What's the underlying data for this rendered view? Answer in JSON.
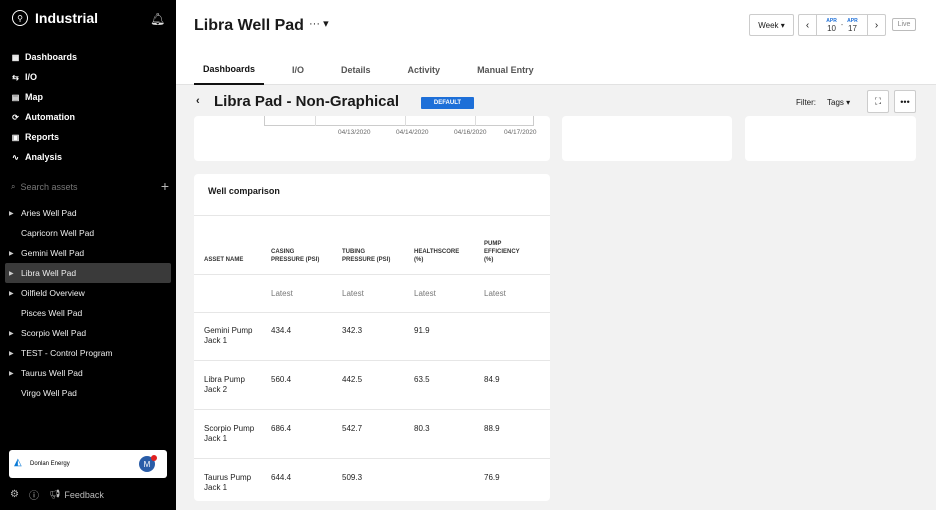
{
  "sidebar": {
    "brand": "Industrial",
    "nav": [
      {
        "icon": "grid-icon",
        "glyph": "▦",
        "label": "Dashboards"
      },
      {
        "icon": "io-icon",
        "glyph": "⇆",
        "label": "I/O"
      },
      {
        "icon": "map-icon",
        "glyph": "▤",
        "label": "Map"
      },
      {
        "icon": "automation-icon",
        "glyph": "⟳",
        "label": "Automation"
      },
      {
        "icon": "reports-icon",
        "glyph": "▣",
        "label": "Reports"
      },
      {
        "icon": "analysis-icon",
        "glyph": "∿",
        "label": "Analysis"
      }
    ],
    "search_placeholder": "Search assets",
    "assets": [
      {
        "label": "Aries Well Pad",
        "expandable": true
      },
      {
        "label": "Capricorn Well Pad",
        "expandable": false
      },
      {
        "label": "Gemini Well Pad",
        "expandable": true
      },
      {
        "label": "Libra Well Pad",
        "expandable": true,
        "active": true
      },
      {
        "label": "Oilfield Overview",
        "expandable": true
      },
      {
        "label": "Pisces Well Pad",
        "expandable": false
      },
      {
        "label": "Scorpio Well Pad",
        "expandable": true
      },
      {
        "label": "TEST - Control Program",
        "expandable": true
      },
      {
        "label": "Taurus Well Pad",
        "expandable": true
      },
      {
        "label": "Virgo Well Pad",
        "expandable": false
      }
    ],
    "org": {
      "name": "Donlan Energy",
      "avatar": "M"
    },
    "footer": {
      "feedback": "Feedback"
    }
  },
  "header": {
    "title": "Libra Well Pad",
    "more": "···",
    "week": "Week",
    "date_start": {
      "month": "APR",
      "day": "10"
    },
    "date_end": {
      "month": "APR",
      "day": "17"
    },
    "date_sep": "-",
    "live": "Live",
    "tabs": [
      "Dashboards",
      "I/O",
      "Details",
      "Activity",
      "Manual Entry"
    ]
  },
  "dashboard": {
    "title": "Libra Pad - Non-Graphical",
    "badge": "DEFAULT",
    "filter_label": "Filter:",
    "tags_label": "Tags"
  },
  "chart_data": {
    "type": "line",
    "x_ticks": [
      "04/13/2020",
      "04/14/2020",
      "04/16/2020",
      "04/17/2020"
    ]
  },
  "table": {
    "title": "Well comparison",
    "columns": [
      [
        "ASSET NAME"
      ],
      [
        "CASING",
        "PRESSURE (PSI)"
      ],
      [
        "TUBING",
        "PRESSURE (PSI)"
      ],
      [
        "HEALTHSCORE",
        "(%)"
      ],
      [
        "PUMP",
        "EFFICIENCY",
        "(%)"
      ]
    ],
    "sub": "Latest",
    "rows": [
      {
        "name": [
          "Gemini Pump",
          "Jack 1"
        ],
        "casing": "434.4",
        "tubing": "342.3",
        "health": "91.9",
        "pump": ""
      },
      {
        "name": [
          "Libra Pump",
          "Jack 2"
        ],
        "casing": "560.4",
        "tubing": "442.5",
        "health": "63.5",
        "pump": "84.9"
      },
      {
        "name": [
          "Scorpio Pump",
          "Jack 1"
        ],
        "casing": "686.4",
        "tubing": "542.7",
        "health": "80.3",
        "pump": "88.9"
      },
      {
        "name": [
          "Taurus Pump",
          "Jack 1"
        ],
        "casing": "644.4",
        "tubing": "509.3",
        "health": "",
        "pump": "76.9"
      }
    ]
  }
}
